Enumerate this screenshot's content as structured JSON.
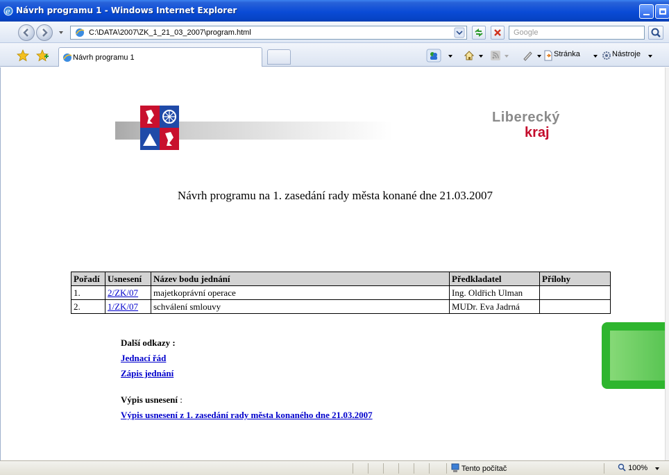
{
  "window": {
    "title": "Návrh programu 1 - Windows Internet Explorer"
  },
  "address_bar": {
    "url": "C:\\DATA\\2007\\ZK_1_21_03_2007\\program.html",
    "search_placeholder": "Google"
  },
  "tabs": [
    {
      "label": "Návrh programu 1"
    }
  ],
  "command_bar": {
    "page_label": "Stránka",
    "tools_label": "Nástroje"
  },
  "page": {
    "brand_line1": "Liberecký",
    "brand_line2": "kraj",
    "heading": "Návrh programu na 1. zasedání rady města konané dne 21.03.2007",
    "table": {
      "headers": [
        "Pořadí",
        "Usnesení",
        "Název bodu jednání",
        "Předkladatel",
        "Přílohy"
      ],
      "rows": [
        {
          "order": "1.",
          "resolution": "2/ZK/07",
          "title": "majetkoprávní operace",
          "presenter": "Ing. Oldřich Ulman",
          "attachments": ""
        },
        {
          "order": "2.",
          "resolution": "1/ZK/07",
          "title": "schválení smlouvy",
          "presenter": "MUDr. Eva Jadrná",
          "attachments": ""
        }
      ]
    },
    "other_links_label": "Další odkazy :",
    "links": [
      "Jednací řád",
      "Zápis jednání"
    ],
    "resolutions_label_bold": "Výpis usnesení",
    "resolutions_label_rest": " :",
    "resolutions_link": "Výpis usnesení z 1. zasedání rady města konaného dne 21.03.2007"
  },
  "status_bar": {
    "zone": "Tento počítač",
    "zoom": "100%"
  },
  "colors": {
    "titlebar": "#0a4bd6",
    "link": "#0000cc",
    "brand_red": "#c40c2c",
    "table_header": "#d3d3d3"
  }
}
